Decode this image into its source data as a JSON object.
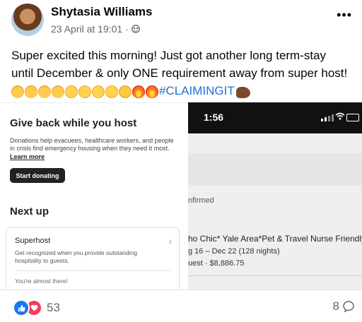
{
  "post": {
    "author": "Shytasia Williams",
    "timestamp": "23 April at 19:01",
    "separator": "·",
    "more_label": "•••",
    "text_line1": "Super excited this morning! Just got another long term-stay",
    "text_line2": "until December & only ONE requirement away from super host!",
    "hashtag": "#CLAIMINGIT",
    "emojis": [
      "party-face-emoji",
      "party-face-emoji",
      "party-face-emoji",
      "party-face-emoji",
      "pleading-face-emoji",
      "pleading-face-emoji",
      "pleading-face-emoji",
      "pleading-face-emoji",
      "smiling-face-with-hearts-emoji",
      "fire-emoji",
      "fire-emoji"
    ]
  },
  "left_screenshot": {
    "title": "Give back while you host",
    "description": "Donations help evacuees, healthcare workers, and people in crisis find emergency housing when they need it most.",
    "learn_more": "Learn more",
    "donate_button": "Start donating",
    "next_up": "Next up",
    "card": {
      "title": "Superhost",
      "description": "Get recognized when you provide outstanding hospitality to guests.",
      "footer": "You're almost there!"
    }
  },
  "right_screenshot": {
    "time": "1:56",
    "status": "nfirmed",
    "listing": "ho Chic* Yale Area*Pet & Travel Nurse Friendly",
    "dates": "g 16 – Dec 22 (128 nights)",
    "guest_price": "uest · $8,886.75"
  },
  "footer": {
    "reaction_count": "53",
    "comment_count": "8"
  },
  "colors": {
    "like_blue": "#1877f2",
    "love_red": "#f33e58",
    "hashtag_blue": "#216fdb",
    "meta_gray": "#65676b"
  }
}
